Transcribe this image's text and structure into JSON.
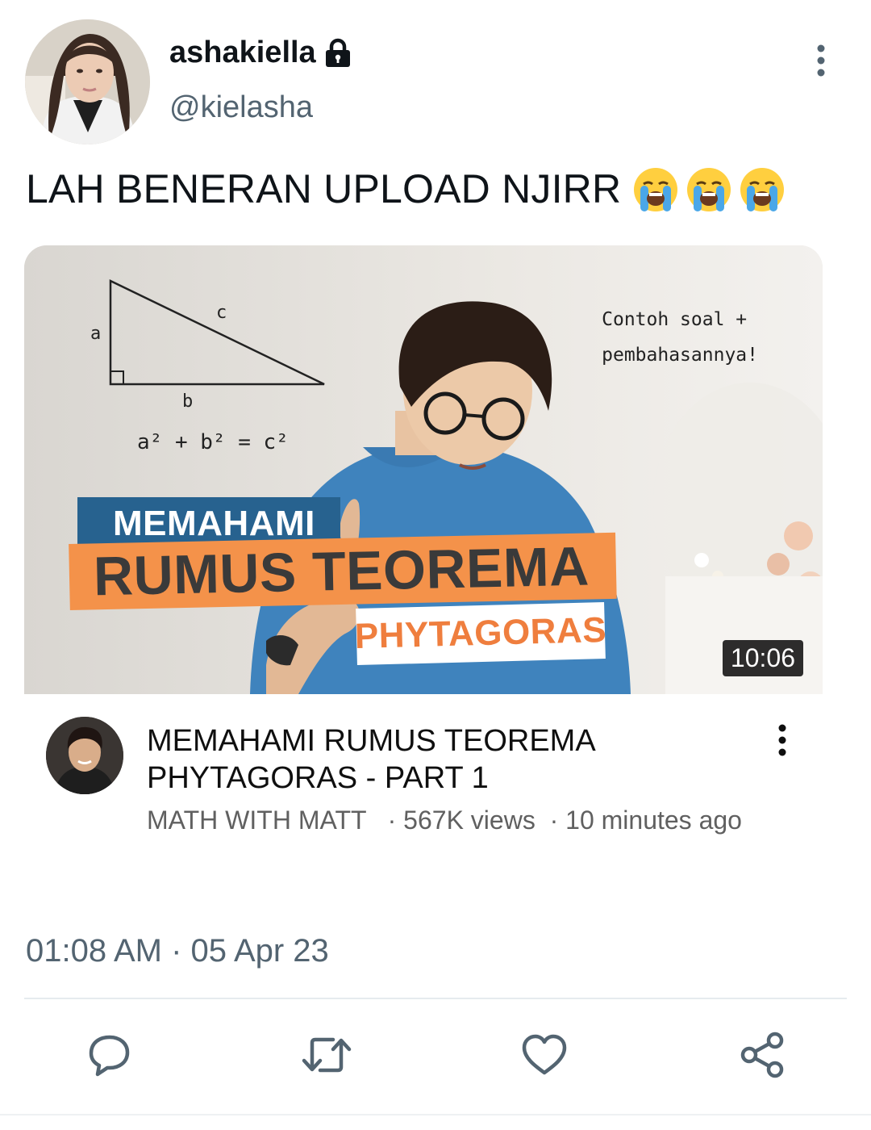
{
  "tweet": {
    "display_name": "ashakiella",
    "handle": "@kielasha",
    "text": "LAH BENERAN UPLOAD NJIRR",
    "emojis": [
      "loudly-crying-face",
      "loudly-crying-face",
      "loudly-crying-face"
    ],
    "timestamp": "01:08 AM · 05 Apr 23"
  },
  "video": {
    "thumbnail": {
      "banner_line1": "MEMAHAMI",
      "banner_line2": "RUMUS TEOREMA",
      "banner_line3": "PHYTAGORAS",
      "note_line1": "Contoh soal +",
      "note_line2": "pembahasannya!",
      "triangle_label_a": "a",
      "triangle_label_b": "b",
      "triangle_label_c": "c",
      "formula": "a² + b² = c²",
      "duration": "10:06"
    },
    "title": "MEMAHAMI RUMUS TEOREMA PHYTAGORAS - PART 1",
    "channel": "MATH WITH MATT",
    "views": "567K views",
    "age": "10 minutes ago"
  },
  "actions": {
    "icons": [
      "reply-icon",
      "retweet-icon",
      "like-icon",
      "share-icon"
    ]
  },
  "colors": {
    "secondary_text": "#536471",
    "banner_blue": "#27628f",
    "banner_orange": "#f4924a"
  }
}
